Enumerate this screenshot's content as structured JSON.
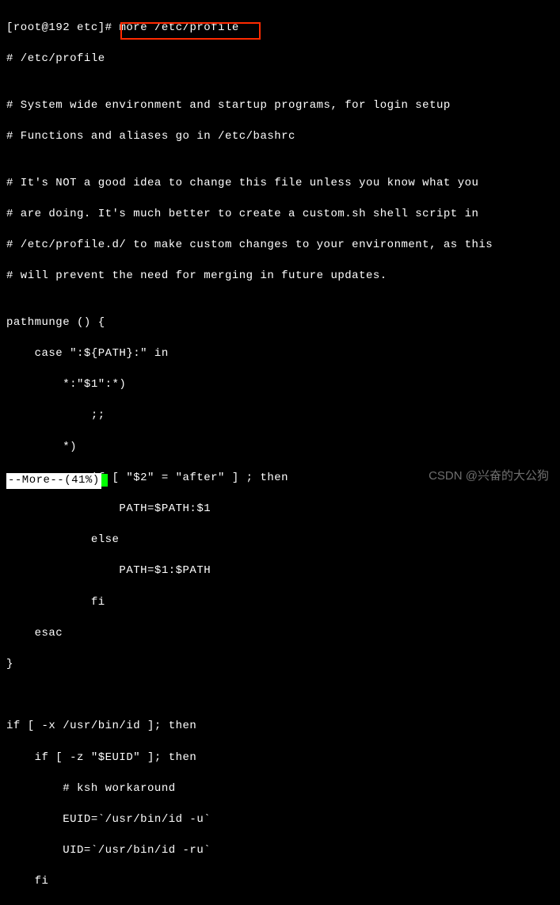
{
  "prompt": {
    "user": "root",
    "at": "@",
    "host": "192",
    "dir": "etc",
    "hash": "#",
    "command": "more /etc/profile"
  },
  "file_output": {
    "lines": [
      "# /etc/profile",
      "",
      "# System wide environment and startup programs, for login setup",
      "# Functions and aliases go in /etc/bashrc",
      "",
      "# It's NOT a good idea to change this file unless you know what you",
      "# are doing. It's much better to create a custom.sh shell script in",
      "# /etc/profile.d/ to make custom changes to your environment, as this",
      "# will prevent the need for merging in future updates.",
      "",
      "pathmunge () {",
      "    case \":${PATH}:\" in",
      "        *:\"$1\":*)",
      "            ;;",
      "        *)",
      "            if [ \"$2\" = \"after\" ] ; then",
      "                PATH=$PATH:$1",
      "            else",
      "                PATH=$1:$PATH",
      "            fi",
      "    esac",
      "}",
      "",
      "",
      "if [ -x /usr/bin/id ]; then",
      "    if [ -z \"$EUID\" ]; then",
      "        # ksh workaround",
      "        EUID=`/usr/bin/id -u`",
      "        UID=`/usr/bin/id -ru`",
      "    fi"
    ]
  },
  "more_status": {
    "label": "--More--(41%)"
  },
  "watermark": {
    "text": "CSDN @兴奋的大公狗"
  }
}
